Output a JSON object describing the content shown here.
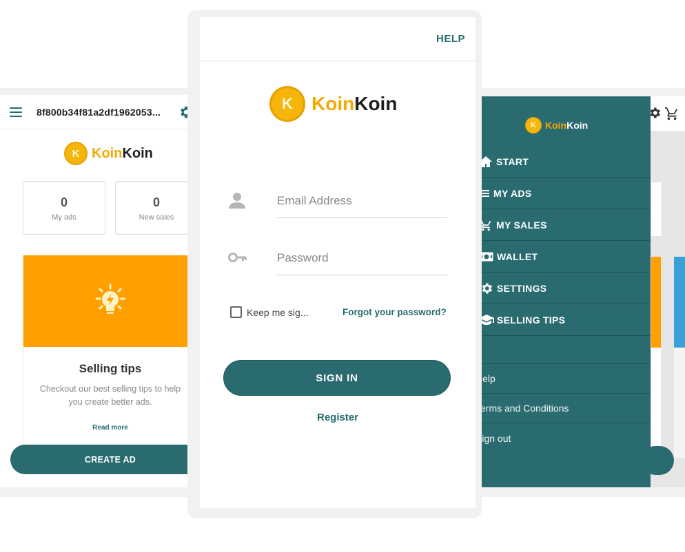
{
  "left_phone": {
    "header_id": "8f800b34f81a2df1962053...",
    "brand": {
      "part1": "Koin",
      "part2": "Koin",
      "coin_letter": "K"
    },
    "stats": [
      {
        "value": "0",
        "label": "My ads"
      },
      {
        "value": "0",
        "label": "New sales"
      }
    ],
    "tips_card": {
      "title": "Selling tips",
      "description": "Checkout our best selling tips to help you create better ads.",
      "link": "Read more",
      "icon": "lightbulb-icon"
    },
    "create_button": "CREATE AD"
  },
  "login": {
    "help": "HELP",
    "brand": {
      "part1": "Koin",
      "part2": "Koin",
      "coin_letter": "K"
    },
    "email_placeholder": "Email Address",
    "password_placeholder": "Password",
    "keep_signed": "Keep me sig...",
    "forgot": "Forgot your password?",
    "sign_in": "SIGN IN",
    "register": "Register"
  },
  "menu": {
    "brand": {
      "part1": "Koin",
      "part2": "Koin",
      "coin_letter": "K"
    },
    "items": [
      {
        "label": "START",
        "icon": "home-icon"
      },
      {
        "label": "MY ADS",
        "icon": "list-icon"
      },
      {
        "label": "MY SALES",
        "icon": "cart-icon"
      },
      {
        "label": "WALLET",
        "icon": "money-icon"
      },
      {
        "label": "SETTINGS",
        "icon": "gear-icon"
      },
      {
        "label": "SELLING TIPS",
        "icon": "graduation-cap-icon"
      }
    ],
    "secondary": [
      {
        "label": "Help"
      },
      {
        "label": "Terms and Conditions"
      },
      {
        "label": "Sign out"
      }
    ]
  },
  "colors": {
    "primary": "#2a6b70",
    "accent": "#ffa000",
    "coin": "#f5b50a",
    "text_dark": "#1e1e1e"
  }
}
